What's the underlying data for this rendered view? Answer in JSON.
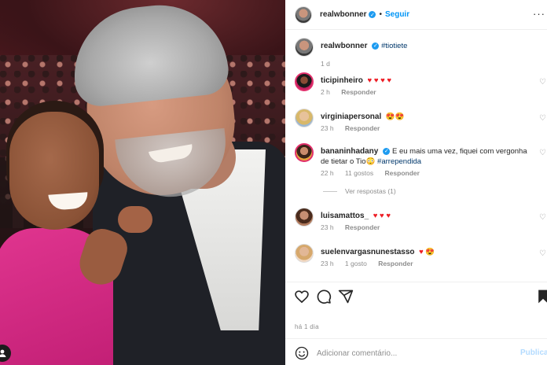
{
  "post": {
    "photo_alt": "selfie",
    "photo_user_tag_icon": "user-icon"
  },
  "header": {
    "username": "realwbonner",
    "verified_icon": "verified-badge-icon",
    "separator": "•",
    "follow_label": "Seguir",
    "more_icon": "more-options-icon",
    "more_glyph": "···"
  },
  "caption": {
    "username": "realwbonner",
    "hashtag": "#tiotiete",
    "time": "1 d"
  },
  "comments": [
    {
      "username": "ticipinheiro",
      "text": "",
      "emoji": "♥ ♥ ♥ ♥",
      "time": "2 h",
      "likes": "",
      "reply": "Responder"
    },
    {
      "username": "virginiapersonal",
      "text": "",
      "emoji": "😍😍",
      "time": "23 h",
      "likes": "",
      "reply": "Responder"
    },
    {
      "username": "bananinhadany",
      "text": "E eu mais uma vez, fiquei com vergonha de tietar o Tio",
      "emoji": "😳",
      "hashtag": "#arrependida",
      "time": "22 h",
      "likes": "11 gostos",
      "reply": "Responder",
      "view_replies": "Ver respostas (1)"
    },
    {
      "username": "luisamattos_",
      "text": "",
      "emoji": "♥ ♥ ♥",
      "time": "23 h",
      "likes": "",
      "reply": "Responder"
    },
    {
      "username": "suelenvargasnunestasso",
      "text": "",
      "emoji": "♥ 😍",
      "time": "23 h",
      "likes": "1 gosto",
      "reply": "Responder"
    }
  ],
  "actions": {
    "like_icon": "heart-icon",
    "comment_icon": "comment-icon",
    "share_icon": "share-icon",
    "save_icon": "bookmark-icon"
  },
  "date_line": "há 1 dia",
  "add_comment": {
    "emoji_icon": "smiley-icon",
    "placeholder": "Adicionar comentário...",
    "post_label": "Publicar"
  },
  "colors": {
    "accent": "#0095f6",
    "heart": "#ed1c24",
    "muted": "#8e8e8e",
    "hashtag": "#00376b"
  }
}
